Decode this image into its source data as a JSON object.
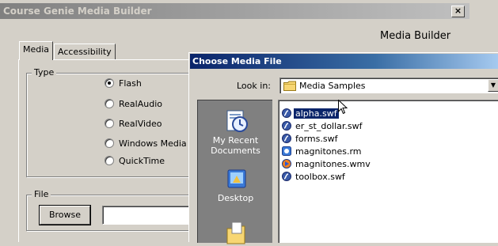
{
  "back_window": {
    "title": "Course Genie Media Builder",
    "close_glyph": "×",
    "header": "Media Builder",
    "tabs": [
      {
        "label": "Media",
        "active": true
      },
      {
        "label": "Accessibility",
        "active": false
      }
    ],
    "type_group": {
      "legend": "Type",
      "options": [
        {
          "label": "Flash",
          "checked": true
        },
        {
          "label": "RealAudio",
          "checked": false
        },
        {
          "label": "RealVideo",
          "checked": false
        },
        {
          "label": "Windows Media",
          "checked": false
        },
        {
          "label": "QuickTime",
          "checked": false
        }
      ]
    },
    "file_group": {
      "legend": "File",
      "browse_label": "Browse",
      "path_value": ""
    }
  },
  "dialog": {
    "title": "Choose Media File",
    "look_in_label": "Look in:",
    "look_in_value": "Media Samples",
    "places": [
      {
        "label": "My Recent Documents",
        "icon": "recent-documents-icon"
      },
      {
        "label": "Desktop",
        "icon": "desktop-icon"
      },
      {
        "label": "",
        "icon": "my-documents-icon"
      }
    ],
    "files": [
      {
        "name": "alpha.swf",
        "type": "swf",
        "selected": true
      },
      {
        "name": "er_st_dollar.swf",
        "type": "swf",
        "selected": false
      },
      {
        "name": "forms.swf",
        "type": "swf",
        "selected": false
      },
      {
        "name": "magnitones.rm",
        "type": "rm",
        "selected": false
      },
      {
        "name": "magnitones.wmv",
        "type": "wmv",
        "selected": false
      },
      {
        "name": "toolbox.swf",
        "type": "swf",
        "selected": false
      }
    ]
  },
  "colors": {
    "face": "#d4d0c8",
    "active_title": "#0a246a",
    "selection": "#0a246a",
    "places_bar": "#808080"
  }
}
